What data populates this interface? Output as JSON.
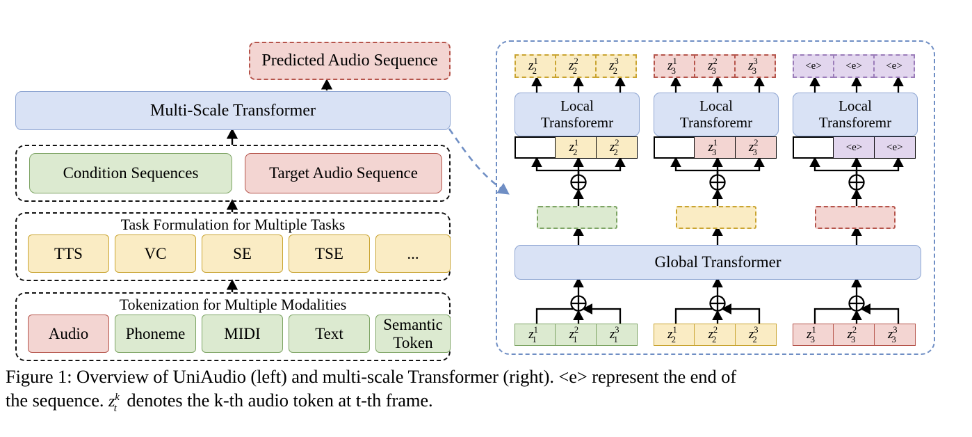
{
  "figure": {
    "caption_line1": "Figure 1: Overview of UniAudio (left) and multi-scale Transformer (right). <e> represent the end of",
    "caption_line2_pre": "the sequence. ",
    "caption_line2_post": " denotes the k-th audio token at t-th frame.",
    "caption_symbol_base": "z",
    "caption_symbol_sup": "k",
    "caption_symbol_sub": "t"
  },
  "colors": {
    "blue_fill": "#d9e2f5",
    "blue_border": "#8ea5d2",
    "green_fill": "#dcead0",
    "green_border": "#7da464",
    "red_fill": "#f3d5d2",
    "red_border": "#b5544b",
    "yellow_fill": "#faecc4",
    "yellow_border": "#c9a431",
    "purple_fill": "#e2d6ee",
    "purple_border": "#9b7cb9",
    "panel_dash": "#6f8ec4",
    "group_dash": "#111111"
  },
  "left": {
    "predicted_audio": "Predicted Audio Sequence",
    "multi_scale_transformer": "Multi-Scale Transformer",
    "sequences_group": {
      "condition": "Condition Sequences",
      "target": "Target Audio Sequence"
    },
    "task_group": {
      "title": "Task Formulation for Multiple Tasks",
      "tasks": [
        "TTS",
        "VC",
        "SE",
        "TSE",
        "..."
      ]
    },
    "token_group": {
      "title": "Tokenization for Multiple Modalities",
      "modalities": [
        "Audio",
        "Phoneme",
        "MIDI",
        "Text",
        "Semantic Token"
      ]
    }
  },
  "right": {
    "global_transformer": "Global Transformer",
    "local_transformer_line1": "Local",
    "local_transformer_line2": "Transforemr",
    "end_token": "<e>",
    "columns": [
      {
        "name": "column-1",
        "color": "green",
        "input_tokens": [
          {
            "base": "z",
            "sup": "1",
            "sub": "1"
          },
          {
            "base": "z",
            "sup": "2",
            "sub": "1"
          },
          {
            "base": "z",
            "sup": "3",
            "sub": "1"
          }
        ],
        "embedding_color": "green",
        "shifted_tokens": [
          {
            "base": "",
            "sup": "",
            "sub": ""
          },
          {
            "base": "z",
            "sup": "1",
            "sub": "2"
          },
          {
            "base": "z",
            "sup": "2",
            "sub": "2"
          }
        ],
        "output_tokens": [
          {
            "base": "z",
            "sup": "1",
            "sub": "2"
          },
          {
            "base": "z",
            "sup": "2",
            "sub": "2"
          },
          {
            "base": "z",
            "sup": "3",
            "sub": "2"
          }
        ],
        "shifted_color": "yellow",
        "output_color": "yellow"
      },
      {
        "name": "column-2",
        "color": "yellow",
        "input_tokens": [
          {
            "base": "z",
            "sup": "1",
            "sub": "2"
          },
          {
            "base": "z",
            "sup": "2",
            "sub": "2"
          },
          {
            "base": "z",
            "sup": "3",
            "sub": "2"
          }
        ],
        "embedding_color": "yellow",
        "shifted_tokens": [
          {
            "base": "",
            "sup": "",
            "sub": ""
          },
          {
            "base": "z",
            "sup": "1",
            "sub": "3"
          },
          {
            "base": "z",
            "sup": "2",
            "sub": "3"
          }
        ],
        "output_tokens": [
          {
            "base": "z",
            "sup": "1",
            "sub": "3"
          },
          {
            "base": "z",
            "sup": "2",
            "sub": "3"
          },
          {
            "base": "z",
            "sup": "3",
            "sub": "3"
          }
        ],
        "shifted_color": "red",
        "output_color": "red"
      },
      {
        "name": "column-3",
        "color": "red",
        "input_tokens": [
          {
            "base": "z",
            "sup": "1",
            "sub": "3"
          },
          {
            "base": "z",
            "sup": "2",
            "sub": "3"
          },
          {
            "base": "z",
            "sup": "3",
            "sub": "3"
          }
        ],
        "embedding_color": "red",
        "shifted_tokens": [
          {
            "text": ""
          },
          {
            "text": "<e>"
          },
          {
            "text": "<e>"
          }
        ],
        "output_tokens": [
          {
            "text": "<e>"
          },
          {
            "text": "<e>"
          },
          {
            "text": "<e>"
          }
        ],
        "shifted_color": "purple",
        "output_color": "purple"
      }
    ]
  }
}
